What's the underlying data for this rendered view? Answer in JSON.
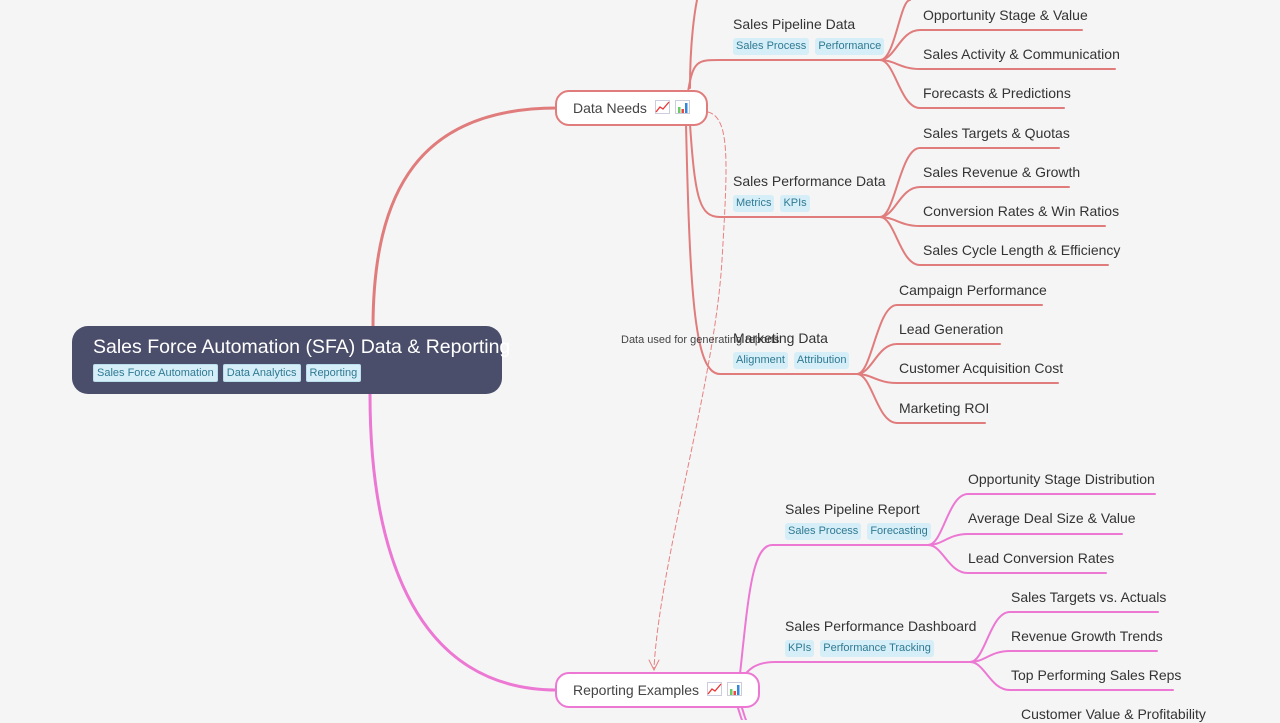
{
  "root": {
    "title": "Sales Force Automation (SFA) Data & Reporting",
    "tags": [
      "Sales Force Automation",
      "Data Analytics",
      "Reporting"
    ]
  },
  "relationship": {
    "label": "Data used for generating reports"
  },
  "colors": {
    "background": "#f5f5f5",
    "root_fill": "#4b4e6b",
    "data_needs_branch": "#e07c7c",
    "reporting_branch": "#ec78d4",
    "tag_fill": "#d6eef7",
    "tag_text": "#2f7a93"
  },
  "branches": [
    {
      "label": "Data Needs",
      "icons": [
        "chart-increasing-icon",
        "bar-chart-icon"
      ],
      "children": [
        {
          "label": "Sales Pipeline Data",
          "tags": [
            "Sales Process",
            "Performance"
          ],
          "leaves": [
            "Opportunity Stage & Value",
            "Sales Activity & Communication",
            "Forecasts & Predictions"
          ]
        },
        {
          "label": "Sales Performance Data",
          "tags": [
            "Metrics",
            "KPIs"
          ],
          "leaves": [
            "Sales Targets & Quotas",
            "Sales Revenue & Growth",
            "Conversion Rates & Win Ratios",
            "Sales Cycle Length & Efficiency"
          ]
        },
        {
          "label": "Marketing Data",
          "tags": [
            "Alignment",
            "Attribution"
          ],
          "leaves": [
            "Campaign Performance",
            "Lead Generation",
            "Customer Acquisition Cost",
            "Marketing ROI"
          ]
        }
      ]
    },
    {
      "label": "Reporting Examples",
      "icons": [
        "chart-increasing-icon",
        "bar-chart-icon"
      ],
      "children": [
        {
          "label": "Sales Pipeline Report",
          "tags": [
            "Sales Process",
            "Forecasting"
          ],
          "leaves": [
            "Opportunity Stage Distribution",
            "Average Deal Size & Value",
            "Lead Conversion Rates"
          ]
        },
        {
          "label": "Sales Performance Dashboard",
          "tags": [
            "KPIs",
            "Performance Tracking"
          ],
          "leaves": [
            "Sales Targets vs. Actuals",
            "Revenue Growth Trends",
            "Top Performing Sales Reps"
          ]
        },
        {
          "label": "",
          "tags": [],
          "leaves": [
            "Customer Value & Profitability"
          ]
        }
      ]
    }
  ]
}
